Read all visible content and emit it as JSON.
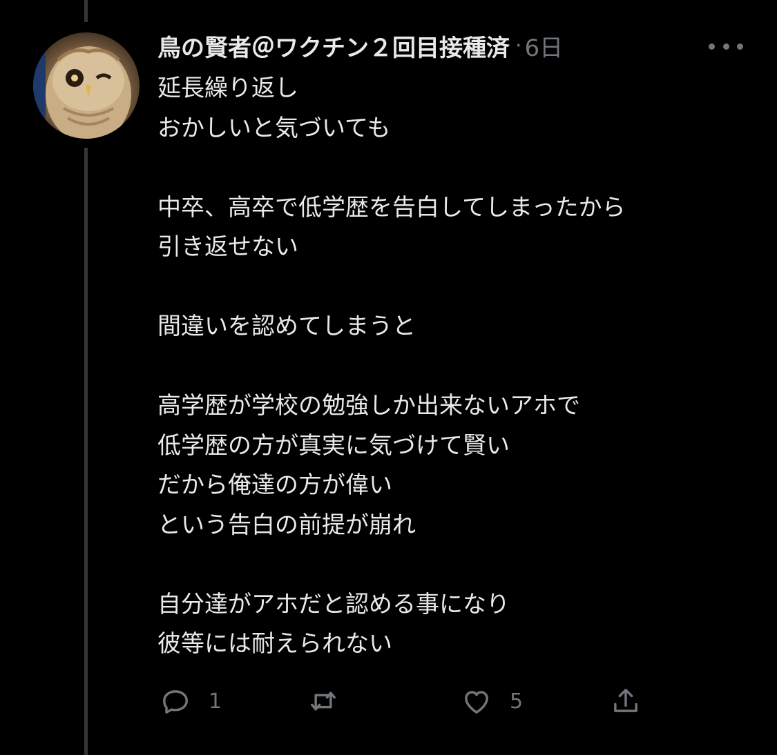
{
  "tweet": {
    "display_name": "鳥の賢者＠ワクチン２回目接種済",
    "separator": "·",
    "time": "6日",
    "avatar_icon": "owl-avatar",
    "more_icon": "more-horizontal-icon",
    "body_lines": [
      "延長繰り返し",
      "おかしいと気づいても",
      "",
      "中卒、高卒で低学歴を告白してしまったから",
      "引き返せない",
      "",
      "間違いを認めてしまうと",
      "",
      "高学歴が学校の勉強しか出来ないアホで",
      "低学歴の方が真実に気づけて賢い",
      "だから俺達の方が偉い",
      "という告白の前提が崩れ",
      "",
      "自分達がアホだと認める事になり",
      "彼等には耐えられない"
    ],
    "actions": {
      "reply_count": "1",
      "retweet_count": "",
      "like_count": "5"
    }
  },
  "colors": {
    "background": "#000000",
    "text": "#e7e9ea",
    "secondary": "#71767b",
    "thread_line": "#333639"
  }
}
